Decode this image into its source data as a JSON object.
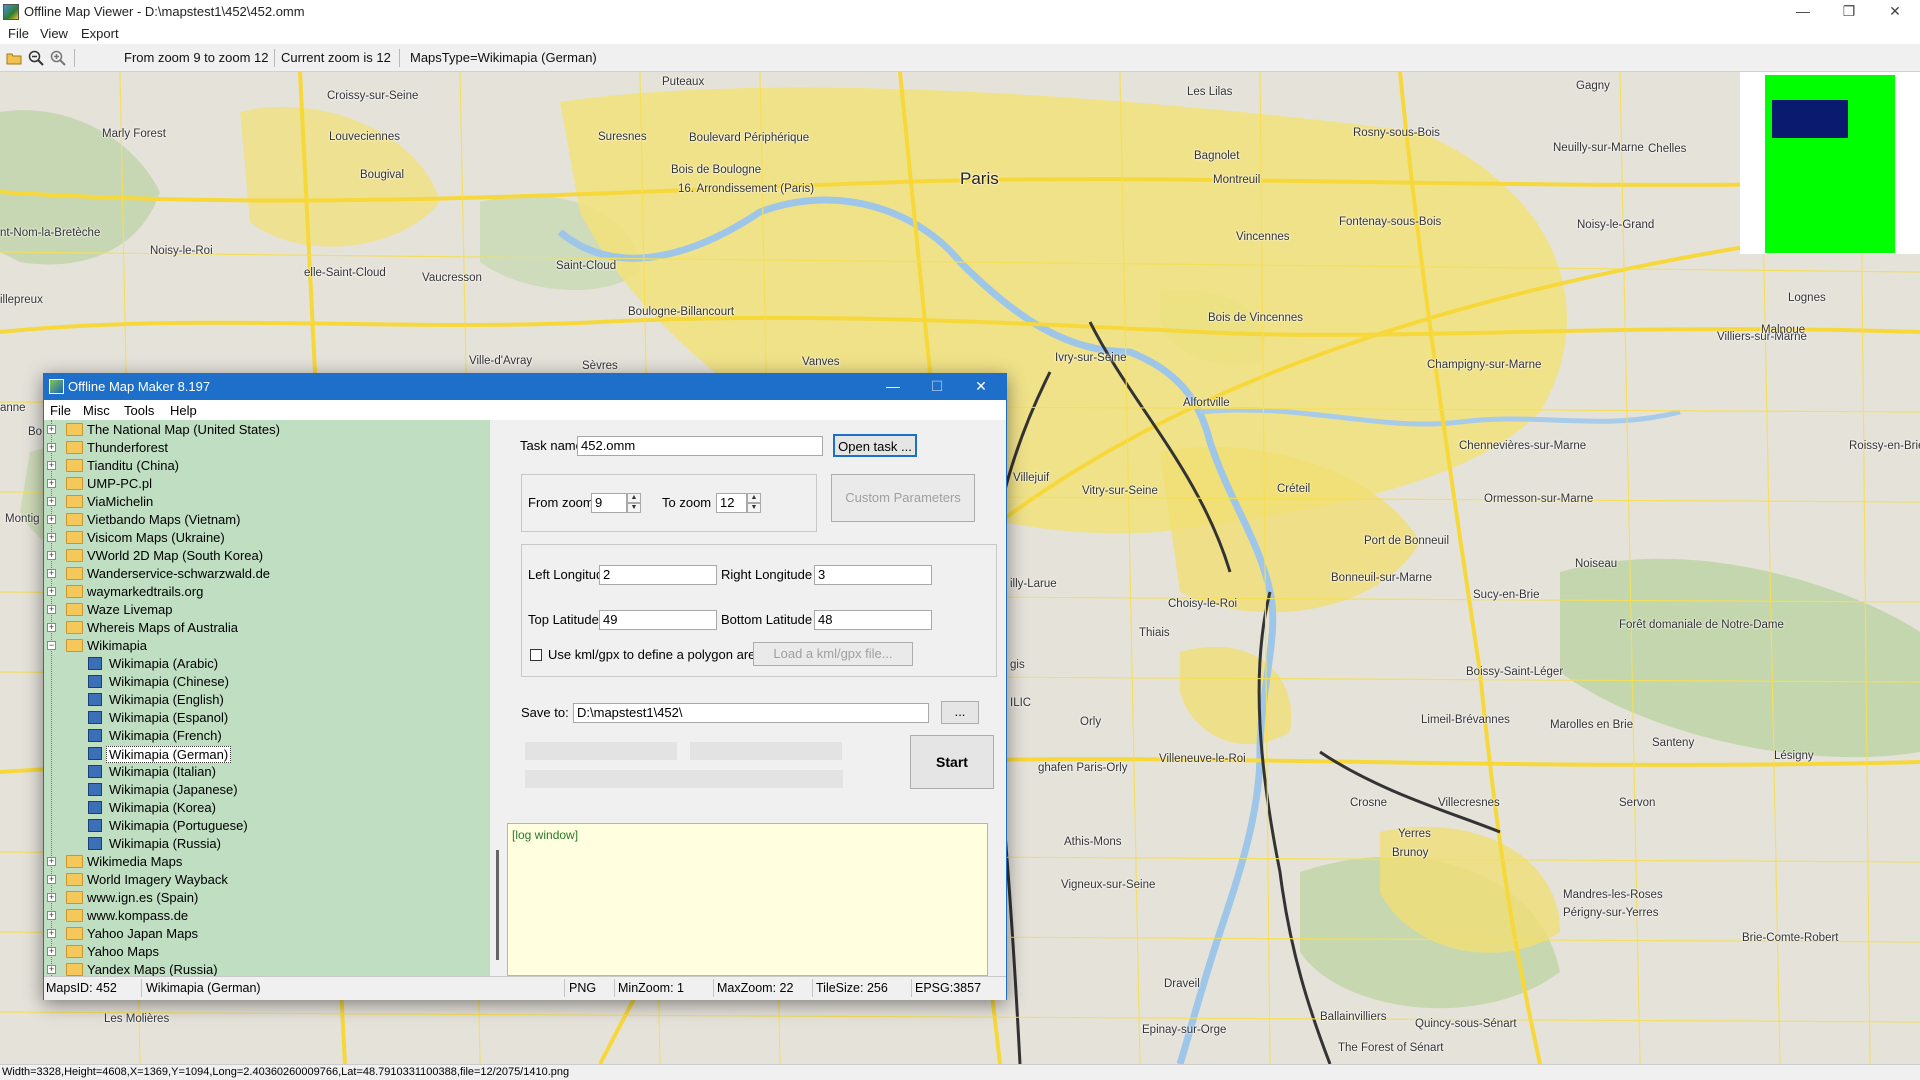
{
  "window": {
    "title": "Offline Map Viewer - D:\\mapstest1\\452\\452.omm",
    "controls": {
      "minimize": "—",
      "restore": "❐",
      "close": "✕"
    }
  },
  "menu": [
    "File",
    "View",
    "Export"
  ],
  "toolbar": {
    "open_icon": "folder-open-icon",
    "zoom_out_icon": "zoom-out-icon",
    "zoom_in_icon": "zoom-in-icon",
    "zoom_range": "From zoom 9 to zoom 12",
    "current_zoom": "Current zoom is 12",
    "maps_type": "MapsType=Wikimapia (German)"
  },
  "map": {
    "places": [
      {
        "name": "Puteaux"
      },
      {
        "name": "Les Lilas"
      },
      {
        "name": "Gagny"
      },
      {
        "name": "Croissy-sur-Seine"
      },
      {
        "name": "Marly Forest"
      },
      {
        "name": "Louveciennes"
      },
      {
        "name": "Suresnes"
      },
      {
        "name": "Boulevard Périphérique"
      },
      {
        "name": "Rosny-sous-Bois"
      },
      {
        "name": "Neuilly-sur-Marne"
      },
      {
        "name": "Chelles"
      },
      {
        "name": "Bagnolet"
      },
      {
        "name": "Bois de Boulogne"
      },
      {
        "name": "Paris",
        "big": true
      },
      {
        "name": "Bougival"
      },
      {
        "name": "16. Arrondissement (Paris)"
      },
      {
        "name": "Montreuil"
      },
      {
        "name": "nt-Nom-la-Bretèche"
      },
      {
        "name": "Fontenay-sous-Bois"
      },
      {
        "name": "Noisy-le-Grand"
      },
      {
        "name": "Vincennes"
      },
      {
        "name": "Noisy-le-Roi"
      },
      {
        "name": "elle-Saint-Cloud"
      },
      {
        "name": "Saint-Cloud"
      },
      {
        "name": "Vaucresson"
      },
      {
        "name": "illepreux"
      },
      {
        "name": "Boulogne-Billancourt"
      },
      {
        "name": "Bois de Vincennes"
      },
      {
        "name": "Lognes"
      },
      {
        "name": "Villiers-sur-Marne"
      },
      {
        "name": "Malnoue"
      },
      {
        "name": "Ville-d'Avray"
      },
      {
        "name": "Vanves"
      },
      {
        "name": "Sèvres"
      },
      {
        "name": "Ivry-sur-Seine"
      },
      {
        "name": "Champigny-sur-Marne"
      },
      {
        "name": "Alfortville"
      },
      {
        "name": "Roissy-en-Brie"
      },
      {
        "name": "Chennevières-sur-Marne"
      },
      {
        "name": "Villejuif"
      },
      {
        "name": "Vitry-sur-Seine"
      },
      {
        "name": "Créteil"
      },
      {
        "name": "Ormesson-sur-Marne"
      },
      {
        "name": "Port de Bonneuil"
      },
      {
        "name": "Noiseau"
      },
      {
        "name": "Montig"
      },
      {
        "name": "Bonneuil-sur-Marne"
      },
      {
        "name": "Sucy-en-Brie"
      },
      {
        "name": "Choisy-le-Roi"
      },
      {
        "name": "illy-Larue"
      },
      {
        "name": "Thiais"
      },
      {
        "name": "Forêt domaniale de Notre-Dame"
      },
      {
        "name": "Boissy-Saint-Léger"
      },
      {
        "name": "Limeil-Brévannes"
      },
      {
        "name": "Marolles en Brie"
      },
      {
        "name": "Santeny"
      },
      {
        "name": "Orly"
      },
      {
        "name": "Villeneuve-le-Roi"
      },
      {
        "name": "Lésigny"
      },
      {
        "name": "ghafen Paris-Orly"
      },
      {
        "name": "Crosne"
      },
      {
        "name": "Villecresnes"
      },
      {
        "name": "Servon"
      },
      {
        "name": "Athis-Mons"
      },
      {
        "name": "Yerres"
      },
      {
        "name": "Brunoy"
      },
      {
        "name": "Vigneux-sur-Seine"
      },
      {
        "name": "Mandres-les-Roses"
      },
      {
        "name": "Périgny-sur-Yerres"
      },
      {
        "name": "Brie-Comte-Robert"
      },
      {
        "name": "Draveil"
      },
      {
        "name": "Les Molières"
      },
      {
        "name": "Ballainvilliers"
      },
      {
        "name": "Epinay-sur-Orge"
      },
      {
        "name": "Quincy-sous-Sénart"
      },
      {
        "name": "The Forest of Sénart"
      },
      {
        "name": "anne"
      },
      {
        "name": "Bo"
      },
      {
        "name": "gis"
      },
      {
        "name": "ILIC"
      }
    ]
  },
  "minimap": {
    "bg_color": "#00ff00",
    "view_color": "#0a1a6e"
  },
  "status": "Width=3328,Height=4608,X=1369,Y=1094,Long=2.40360260009766,Lat=48.7910331100388,file=12/2075/1410.png",
  "dialog": {
    "title": "Offline Map Maker 8.197",
    "controls": {
      "minimize": "—",
      "maximize": "☐",
      "close": "✕"
    },
    "menu": [
      "File",
      "Misc",
      "Tools",
      "Help"
    ],
    "tree": [
      {
        "label": "The National Map (United States)",
        "type": "folder"
      },
      {
        "label": "Thunderforest",
        "type": "folder"
      },
      {
        "label": "Tianditu (China)",
        "type": "folder"
      },
      {
        "label": "UMP-PC.pl",
        "type": "folder"
      },
      {
        "label": "ViaMichelin",
        "type": "folder"
      },
      {
        "label": "Vietbando Maps (Vietnam)",
        "type": "folder"
      },
      {
        "label": "Visicom Maps (Ukraine)",
        "type": "folder"
      },
      {
        "label": "VWorld 2D Map (South Korea)",
        "type": "folder"
      },
      {
        "label": "Wanderservice-schwarzwald.de",
        "type": "folder"
      },
      {
        "label": "waymarkedtrails.org",
        "type": "folder"
      },
      {
        "label": "Waze Livemap",
        "type": "folder"
      },
      {
        "label": "Whereis Maps of Australia",
        "type": "folder"
      },
      {
        "label": "Wikimapia",
        "type": "folder-open"
      },
      {
        "label": "Wikimapia (Arabic)",
        "type": "child"
      },
      {
        "label": "Wikimapia (Chinese)",
        "type": "child"
      },
      {
        "label": "Wikimapia (English)",
        "type": "child"
      },
      {
        "label": "Wikimapia (Espanol)",
        "type": "child"
      },
      {
        "label": "Wikimapia (French)",
        "type": "child"
      },
      {
        "label": "Wikimapia (German)",
        "type": "child",
        "selected": true
      },
      {
        "label": "Wikimapia (Italian)",
        "type": "child"
      },
      {
        "label": "Wikimapia (Japanese)",
        "type": "child"
      },
      {
        "label": "Wikimapia (Korea)",
        "type": "child"
      },
      {
        "label": "Wikimapia (Portuguese)",
        "type": "child"
      },
      {
        "label": "Wikimapia (Russia)",
        "type": "child"
      },
      {
        "label": "Wikimedia Maps",
        "type": "folder"
      },
      {
        "label": "World Imagery Wayback",
        "type": "folder"
      },
      {
        "label": "www.ign.es (Spain)",
        "type": "folder"
      },
      {
        "label": "www.kompass.de",
        "type": "folder"
      },
      {
        "label": "Yahoo Japan Maps",
        "type": "folder"
      },
      {
        "label": "Yahoo Maps",
        "type": "folder"
      },
      {
        "label": "Yandex Maps (Russia)",
        "type": "folder"
      }
    ],
    "form": {
      "task_name_label": "Task name",
      "task_name": "452.omm",
      "open_task": "Open task ...",
      "from_zoom_label": "From zoom",
      "from_zoom": "9",
      "to_zoom_label": "To zoom",
      "to_zoom": "12",
      "custom_params": "Custom Parameters",
      "left_lon_label": "Left Longitude",
      "left_lon": "2",
      "right_lon_label": "Right Longitude",
      "right_lon": "3",
      "top_lat_label": "Top Latitude",
      "top_lat": "49",
      "bottom_lat_label": "Bottom Latitude",
      "bottom_lat": "48",
      "use_kml_label": "Use kml/gpx to define a polygon area",
      "use_kml_checked": false,
      "load_kml": "Load a kml/gpx file...",
      "save_to_label": "Save to:",
      "save_to": "D:\\mapstest1\\452\\",
      "browse": "...",
      "start": "Start"
    },
    "log": "[log window]",
    "status": {
      "maps_id": "MapsID: 452",
      "map_name": "Wikimapia (German)",
      "format": "PNG",
      "min_zoom": "MinZoom: 1",
      "max_zoom": "MaxZoom: 22",
      "tile_size": "TileSize: 256",
      "epsg": "EPSG:3857"
    }
  }
}
